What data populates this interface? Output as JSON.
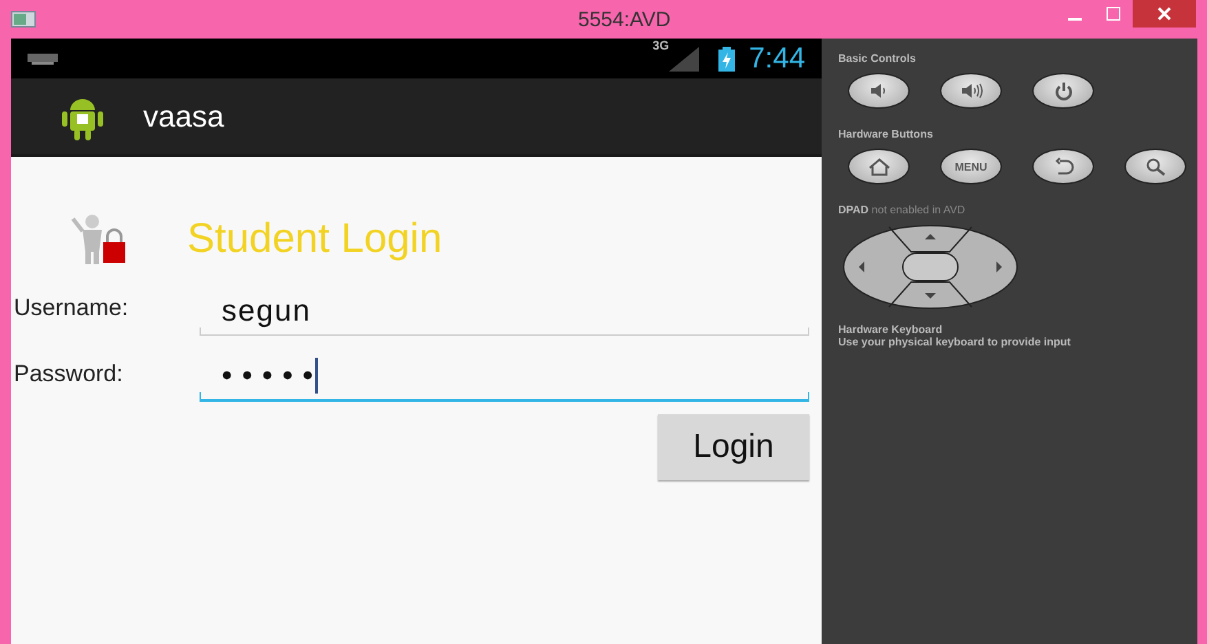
{
  "window": {
    "title": "5554:AVD"
  },
  "status_bar": {
    "network": "3G",
    "time": "7:44"
  },
  "action_bar": {
    "title": "vaasa"
  },
  "login": {
    "heading": "Student Login",
    "fields": [
      {
        "label": "Username:",
        "value": "segun",
        "focused": false
      },
      {
        "label": "Password:",
        "value": "•••••",
        "focused": true
      }
    ],
    "button": "Login"
  },
  "controls": {
    "sections": [
      {
        "title": "Basic Controls",
        "buttons": [
          {
            "kind": "volume-down"
          },
          {
            "kind": "volume-up"
          },
          {
            "kind": "power"
          }
        ]
      },
      {
        "title": "Hardware Buttons",
        "buttons": [
          {
            "kind": "home"
          },
          {
            "kind": "text",
            "label": "MENU"
          },
          {
            "kind": "back"
          },
          {
            "kind": "search"
          }
        ]
      }
    ],
    "dpad": {
      "note": "**DPAD** not enabled in AVD"
    },
    "keyboard": {
      "title": "Hardware Keyboard",
      "note": "Use your physical keyboard to provide input"
    }
  }
}
